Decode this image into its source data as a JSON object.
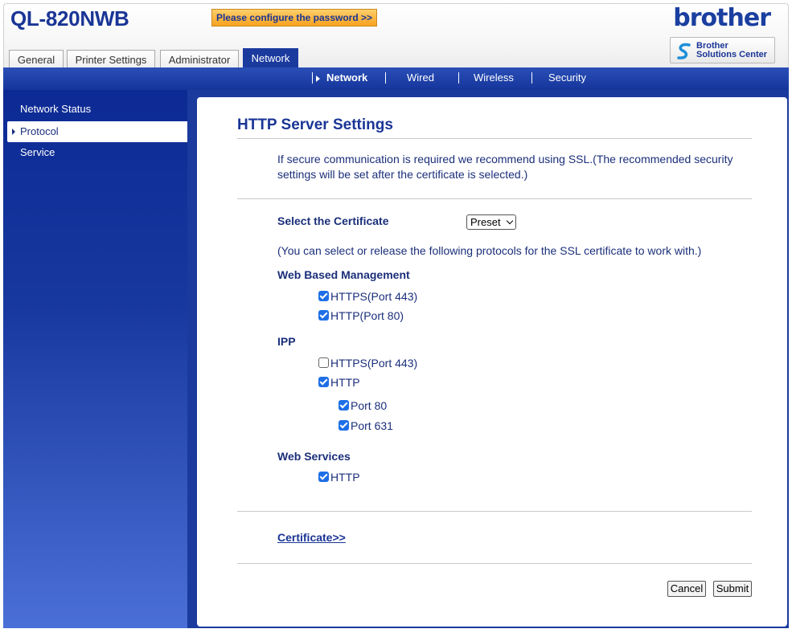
{
  "header": {
    "model": "QL-820NWB",
    "password_button": "Please configure the password >>",
    "logo": "brother",
    "solutions_center": [
      "Brother",
      "Solutions Center"
    ]
  },
  "tabs": [
    {
      "label": "General"
    },
    {
      "label": "Printer Settings"
    },
    {
      "label": "Administrator"
    },
    {
      "label": "Network",
      "active": true
    }
  ],
  "subnav": [
    {
      "label": "Network",
      "active": true
    },
    {
      "label": "Wired"
    },
    {
      "label": "Wireless"
    },
    {
      "label": "Security"
    }
  ],
  "sidebar": {
    "items": [
      {
        "label": "Network Status"
      },
      {
        "label": "Protocol",
        "active": true
      },
      {
        "label": "Service"
      }
    ]
  },
  "main": {
    "title": "HTTP Server Settings",
    "description": "If secure communication is required we recommend using SSL.(The recommended security settings will be set after the certificate is selected.)",
    "certificate_label": "Select the Certificate",
    "certificate_value": "Preset",
    "protocols_note": "(You can select or release the following protocols for the SSL certificate to work with.)",
    "web_based_management": {
      "heading": "Web Based Management",
      "https": {
        "label": "HTTPS(Port 443)",
        "checked": true
      },
      "http": {
        "label": "HTTP(Port 80)",
        "checked": true
      }
    },
    "ipp": {
      "heading": "IPP",
      "https": {
        "label": "HTTPS(Port 443)",
        "checked": false
      },
      "http": {
        "label": "HTTP",
        "checked": true
      },
      "port80": {
        "label": "Port 80",
        "checked": true
      },
      "port631": {
        "label": "Port 631",
        "checked": true
      }
    },
    "web_services": {
      "heading": "Web Services",
      "http": {
        "label": "HTTP",
        "checked": true
      }
    },
    "certificate_link": "Certificate>>",
    "cancel_label": "Cancel",
    "submit_label": "Submit"
  },
  "colors": {
    "brand_blue": "#1a3a9e",
    "checkbox_blue": "#1e6fe6",
    "password_orange": "#f7a21f"
  }
}
